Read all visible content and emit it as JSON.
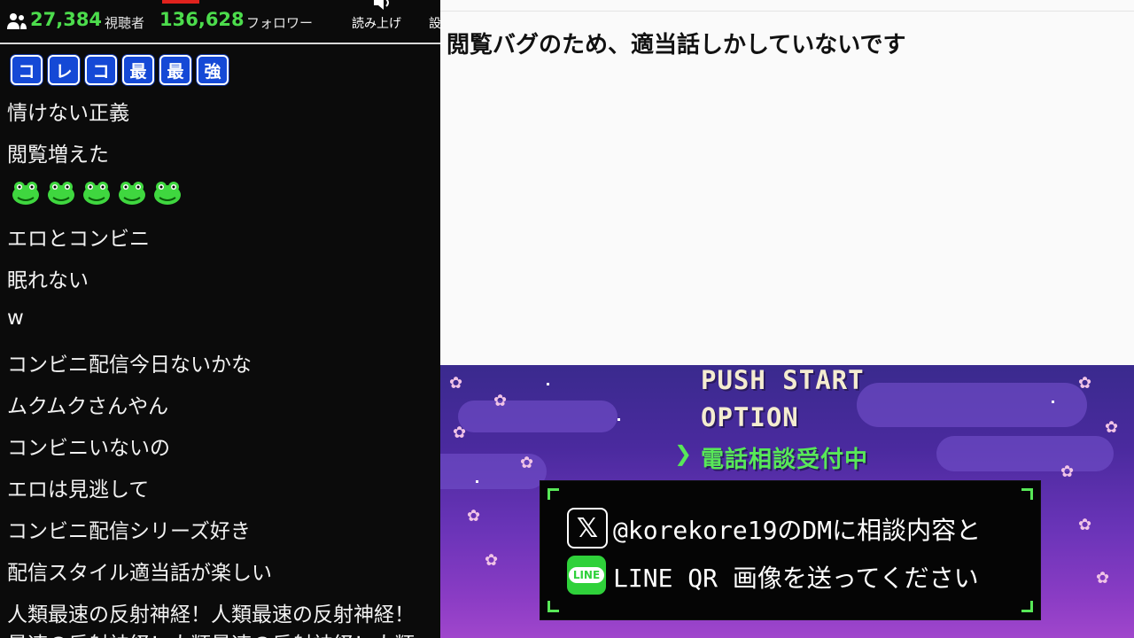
{
  "header": {
    "viewers_count": "27,384",
    "viewers_label": "視聴者",
    "followers_count": "136,628",
    "followers_label": "フォロワー",
    "read_aloud_label": "読み上げ",
    "settings_label_cut": "設"
  },
  "comments": {
    "stamp_row": [
      "コ",
      "レ",
      "コ",
      "最",
      "最",
      "強"
    ],
    "c1": "情けない正義",
    "c2": "閲覧増えた",
    "c3": "エロとコンビニ",
    "c4": "眠れない",
    "c5": "w",
    "c6": "コンビニ配信今日ないかな",
    "c7": "ムクムクさんやん",
    "c8": "コンビニいないの",
    "c9": "エロは見逃して",
    "c10": "コンビニ配信シリーズ好き",
    "c11": "配信スタイル適当話が楽しい",
    "c12": "人類最速の反射神経！人類最速の反射神経！",
    "c13": "最速の反射神経！人類最速の反射神経！人類"
  },
  "note": {
    "text": "閲覧バグのため、適当話しかしていないです"
  },
  "game": {
    "menu_start": "PUSH START",
    "menu_option": "OPTION",
    "menu_phone": "電話相談受付中",
    "cursor": "❯",
    "x_glyph": "𝕏",
    "line_badge": "LINE",
    "dm_text": "@korekore19のDMに相談内容と",
    "line_text": "LINE QR 画像を送ってください"
  },
  "colors": {
    "accent_green": "#4cdc4c",
    "stamp_blue": "#1549d6",
    "live_red": "#e0221d"
  }
}
